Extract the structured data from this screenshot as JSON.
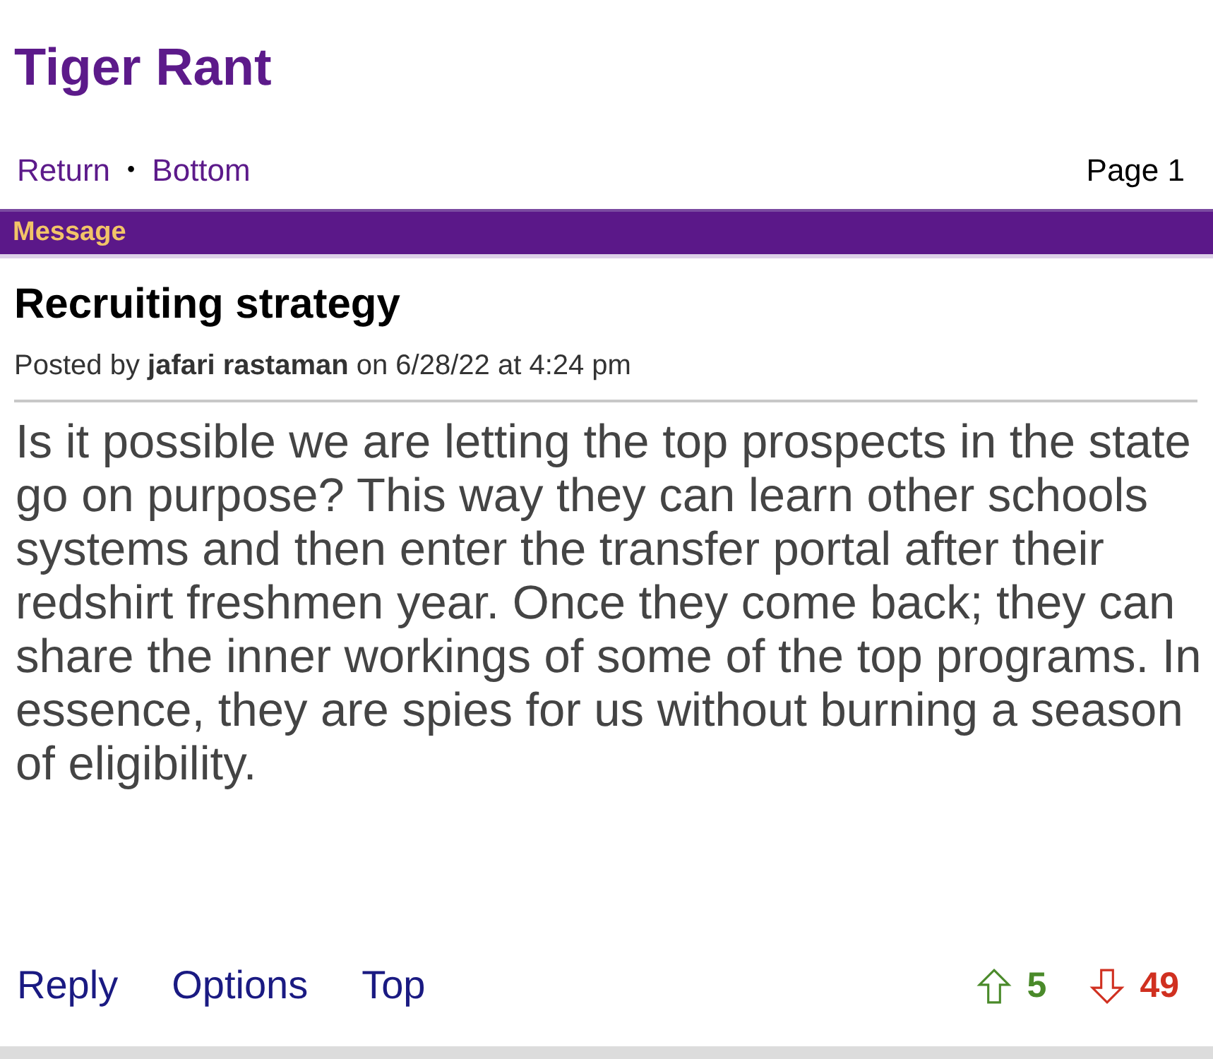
{
  "site_title": "Tiger Rant",
  "nav": {
    "links": [
      "Return",
      "Bottom"
    ],
    "separator": "•",
    "page": "Page 1"
  },
  "section_bar": "Message",
  "post": {
    "subject": "Recruiting strategy",
    "meta": "Posted by **jafari rastaman** on 6/28/22 at 4:24 pm",
    "body": "Is it possible we are letting the top prospects in the state go on purpose? This way they can learn other schools systems and then enter the transfer portal after their redshirt freshmen year. Once they come back; they can share the inner workings of some of the top programs. In essence, they are spies for us without burning a season of eligibility."
  },
  "actions": [
    "Reply",
    "Options",
    "Top"
  ],
  "votes": [
    {
      "kind": "up",
      "count": "5",
      "color": "#4a8a2a"
    },
    {
      "kind": "down",
      "count": "49",
      "color": "#d03020"
    }
  ]
}
